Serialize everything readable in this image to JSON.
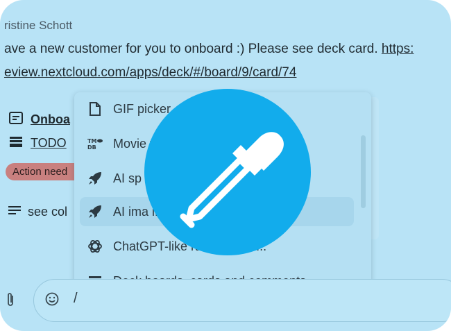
{
  "message": {
    "author": "ristine Schott",
    "text_prefix": "ave a new customer for you to onboard :) Please see deck card. ",
    "link_start": "https:",
    "link_rest": "eview.nextcloud.com/apps/deck/#/board/9/card/74"
  },
  "card": {
    "title": "Onboa",
    "list": "TODO",
    "badge": "Action need",
    "description": "see col"
  },
  "picker": {
    "items": [
      {
        "icon": "file-icon",
        "label": "GIF picker"
      },
      {
        "icon": "tmdb-icon",
        "label": "Movie                                         y The..."
      },
      {
        "icon": "rocket-icon",
        "label": "AI sp                                         Rep..."
      },
      {
        "icon": "rocket-icon",
        "label": "AI ima                                        iffusi..."
      },
      {
        "icon": "openai-icon",
        "label": "ChatGPT-like                  ration (by O..."
      },
      {
        "icon": "deck-icon",
        "label": "Deck boards, cards and comments"
      }
    ]
  },
  "composer": {
    "input_value": "/"
  },
  "overlay": {
    "icon": "color-picker-dropper-icon",
    "color": "#12acec"
  },
  "colors": {
    "background": "#b8e3f6",
    "accent": "#12acec",
    "badge": "#c9807f"
  }
}
